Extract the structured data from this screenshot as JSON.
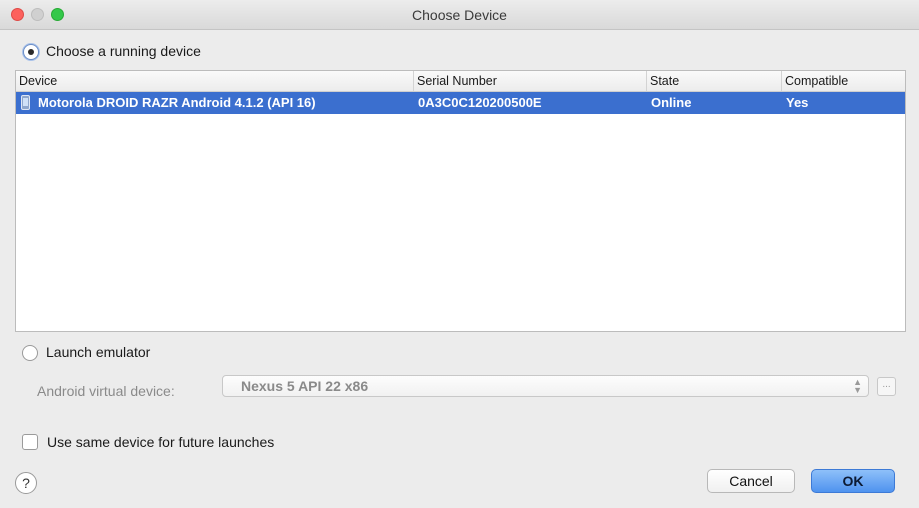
{
  "window": {
    "title": "Choose Device"
  },
  "running": {
    "label": "Choose a running device"
  },
  "table": {
    "columns": [
      "Device",
      "Serial Number",
      "State",
      "Compatible"
    ],
    "rows": [
      {
        "device": "Motorola DROID RAZR Android 4.1.2 (API 16)",
        "serial": "0A3C0C120200500E",
        "state": "Online",
        "compatible": "Yes"
      }
    ]
  },
  "emulator": {
    "label": "Launch emulator",
    "avd_label": "Android virtual device:",
    "avd_value": "Nexus 5 API 22 x86",
    "browse_label": "..."
  },
  "future": {
    "label": "Use same device for future launches"
  },
  "help": {
    "label": "?"
  },
  "buttons": {
    "cancel": "Cancel",
    "ok": "OK"
  },
  "colors": {
    "selection": "#3b6fcf",
    "ok_button": "#5b9bf1"
  }
}
